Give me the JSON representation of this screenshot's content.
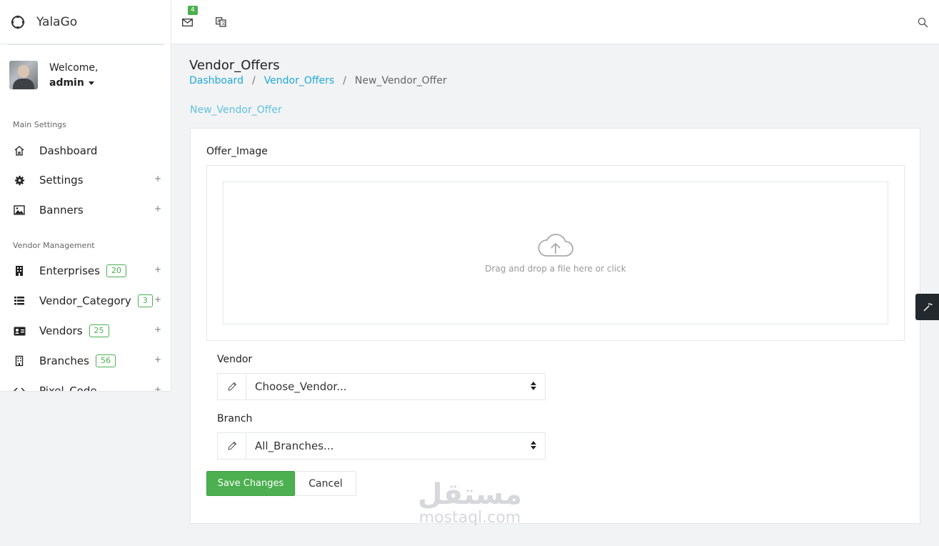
{
  "brand": {
    "name": "YalaGo"
  },
  "user": {
    "welcome": "Welcome,",
    "name": "admin"
  },
  "sidebar": {
    "sections": [
      {
        "title": "Main Settings"
      },
      {
        "title": "Vendor Management"
      }
    ],
    "items": [
      {
        "label": "Dashboard",
        "icon": "home-icon",
        "plus": ""
      },
      {
        "label": "Settings",
        "icon": "gear-icon",
        "plus": "+"
      },
      {
        "label": "Banners",
        "icon": "image-icon",
        "plus": "+"
      },
      {
        "label": "Enterprises",
        "icon": "building-icon",
        "badge": "20",
        "plus": "+"
      },
      {
        "label": "Vendor_Category",
        "icon": "list-icon",
        "badge": "3",
        "plus": "+"
      },
      {
        "label": "Vendors",
        "icon": "id-card-icon",
        "badge": "25",
        "plus": "+"
      },
      {
        "label": "Branches",
        "icon": "building-outline-icon",
        "badge": "56",
        "plus": "+"
      },
      {
        "label": "Pixel_Code",
        "icon": "code-icon",
        "plus": "+"
      }
    ]
  },
  "topbar": {
    "mail_count": "4",
    "icons": [
      "mail-icon",
      "translate-icon",
      "search-icon"
    ]
  },
  "page": {
    "title": "Vendor_Offers",
    "breadcrumb": [
      "Dashboard",
      "Vendor_Offers",
      "New_Vendor_Offer"
    ],
    "breadcrumb_sep": "/",
    "card_title": "New_Vendor_Offer"
  },
  "form": {
    "image_label": "Offer_Image",
    "dropzone_text": "Drag and drop a file here or click",
    "vendor_label": "Vendor",
    "vendor_selected": "Choose_Vendor...",
    "branch_label": "Branch",
    "branch_selected": "All_Branches...",
    "save_label": "Save Changes",
    "cancel_label": "Cancel"
  },
  "watermark": {
    "arabic": "مستقل",
    "latin": "mostaql.com"
  },
  "colors": {
    "accent": "#20a8d8",
    "success": "#4caf50",
    "card_title": "#63c2de"
  }
}
